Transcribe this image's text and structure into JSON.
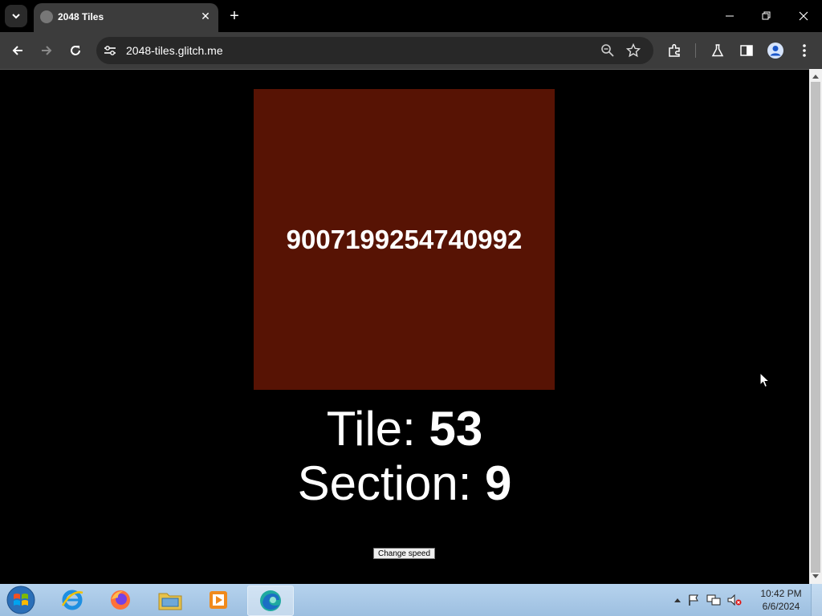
{
  "browser": {
    "tab": {
      "title": "2048 Tiles"
    },
    "address_bar": {
      "url": "2048-tiles.glitch.me"
    }
  },
  "game": {
    "tile_value": "9007199254740992",
    "tile_color": "#571304",
    "tile_label": "Tile: ",
    "tile_number": "53",
    "section_label": "Section: ",
    "section_number": "9",
    "change_speed_label": "Change speed"
  },
  "taskbar": {
    "items": [
      "Internet Explorer",
      "Firefox",
      "Windows Explorer",
      "Media Player",
      "Microsoft Edge"
    ],
    "clock": {
      "time": "10:42 PM",
      "date": "6/6/2024"
    }
  }
}
